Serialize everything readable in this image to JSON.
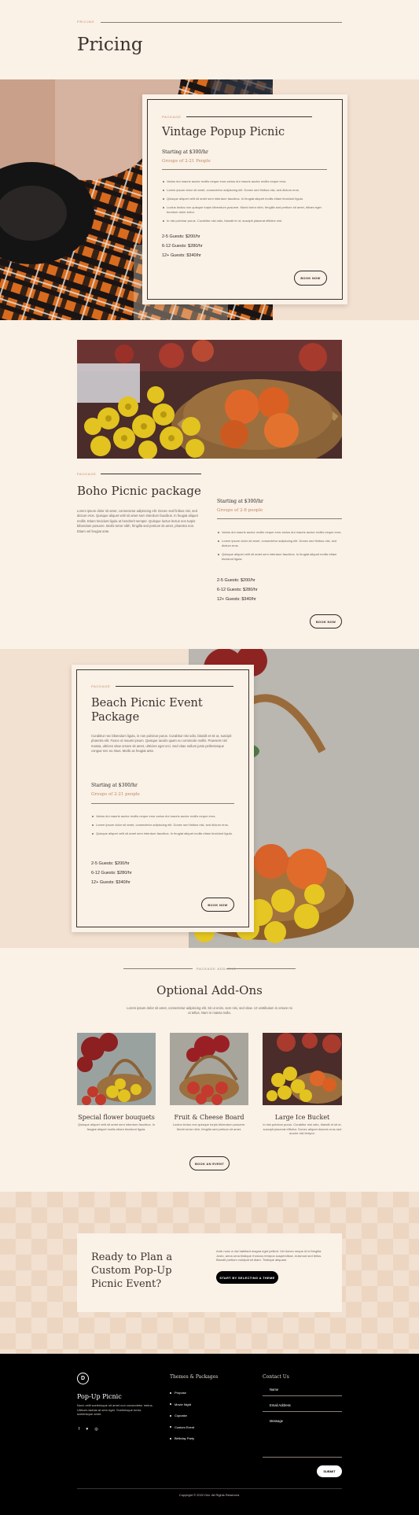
{
  "hero": {
    "eyebrow": "PRICING",
    "title": "Pricing"
  },
  "package1": {
    "eyebrow": "PACKAGE",
    "title": "Vintage Popup Picnic",
    "starting": "Starting at $300/hr",
    "groups": "Groups of 2-21 People",
    "bullets": [
      "Varius dui mauris auctor mollis neque eros varius dui mauris auctor mollis neque eros.",
      "Lorem ipsum dolor sit amet, consectetur adipiscing elit. Donec sed finibus nisi, sed dictum eros.",
      "Quisque aliquet velit sit amet sem interdum faucibus. In feugiat aliquet mollis etiam tincidunt ligula.",
      "Luctus lectus non quisque turpis bibendum posuere. Morbi tortor nibh, fringilla sed pretium sit amet, dibam eget bendum dolor tortor.",
      "In nisi pulvinar purus. Curabitur nisi odio, blandit et ut, suscipit placerat efficitur nisi."
    ],
    "tiers": [
      "2-5 Guests: $200/hr",
      "6-12 Guests: $280/hr",
      "12+ Guests: $340/hr"
    ],
    "button": "BOOK NOW"
  },
  "package2": {
    "eyebrow": "PACKAGE",
    "title": "Boho Picnic package",
    "desc": "Lorem ipsum dolor sit amet, consectetur adipiscing elit. Donec sed finibus nisi, sed dictum eros. Quisque aliquet velit sit amet sem interdum faucibus. In feugiat aliquet mollis. Etiam tincidunt ligula at hendrerit semper. Quisque luctus lectus non turpis bibendum posuere. Morbi tortor nibh, fringilla sed pretium sit amet, pharetra non. Etiam vel feugiat ante.",
    "starting": "Starting at $300/hr",
    "groups": "Groups of 2-8 people",
    "bullets": [
      "Varius dui mauris auctor mollis neque eros varius dui mauris auctor mollis neque eros.",
      "Lorem ipsum dolor sit amet, consectetur adipiscing elit. Donec sed finibus nisi, sed dictum eros.",
      "Quisque aliquet velit sit amet sem interdum faucibus. In feugiat aliquet mollis etiam tincidunt ligula."
    ],
    "tiers": [
      "2-5 Guests: $200/hr",
      "6-12 Guests: $280/hr",
      "12+ Guests: $340/hr"
    ],
    "button": "BOOK NOW"
  },
  "package3": {
    "eyebrow": "PACKAGE",
    "title": "Beach Picnic Event Package",
    "desc": "Curabitur nec bibendum ligula, in non pulvinar purus. Curabitur nisi odio, blandit et sit ut, suscipit pharetra elit. Fusce ut mauris ipsum. Quisque iaculis quam eu commodo mollis. Praesent nisl massa, ultrices vitae ornare sit amet, ultricies eget orci. Sed vitae nullum justo pellentesque congue nec eu risus. Morbi ac feugiat ante.",
    "starting": "Starting at $300/hr",
    "groups": "Groups of 2-21 people",
    "bullets": [
      "Varius dui mauris auctor mollis neque eros varius dui mauris auctor mollis neque eros.",
      "Lorem ipsum dolor sit amet, consectetur adipiscing elit. Donec sed finibus nisi, sed dictum eros.",
      "Quisque aliquet velit sit amet sem interdum faucibus. In feugiat aliquet mollis etiam tincidunt ligula."
    ],
    "tiers": [
      "2-5 Guests: $200/hr",
      "6-12 Guests: $280/hr",
      "12+ Guests: $340/hr"
    ],
    "button": "BOOK NOW"
  },
  "addons": {
    "eyebrow": "PACKAGE ADD-ONS",
    "title": "Optional Add-Ons",
    "desc": "Lorem ipsum dolor sit amet, consectetur adipiscing elit. Sit ut enim, sem nisi, sed vitae. Ut vestibulum in ornare mi ut tellus. Nam in massa nulla.",
    "items": [
      {
        "title": "Special flower bouquets",
        "desc": "Quisque aliquet velit sit amet sem interdum faucibus. In feugiat aliquet mollis etiam tincidunt ligula."
      },
      {
        "title": "Fruit & Cheese Board",
        "desc": "Luctus lectus non quisque turpis bibendum posuere. Morbi tortor nibh, fringilla sed pretium sit amet."
      },
      {
        "title": "Large Ice Bucket",
        "desc": "In nisi pulvinar purus. Curabitur nisi odio, blandit et sit ut, suscipit placerat efficitur. Donec aliquet dolores eros sed auctor nisl tempor."
      }
    ],
    "button": "BOOK AN EVENT"
  },
  "cta": {
    "title": "Ready to Plan a Custom Pop-Up Picnic Event?",
    "desc": "Ante nunc a nisi habitant magna eget pellent. Vel donec neque id id fringilla. Justo, anna urna tristique rhoncus tempus suspendisse, euismod sed tellus. Blandit pretium volutpat sit diam. Tristique aliquam.",
    "button": "START BY SELECTING A THEME"
  },
  "footer": {
    "logo": "D",
    "brand": "Pop-Up Picnic",
    "blurb": "Nunc velit scelerisque sit amet non consectetur metus. Ultrices lacinia at sem eget. Scelerisque tortor, scelerisque amet.",
    "nav_title": "Themes & Packages",
    "nav": [
      "Propose",
      "Movie Night",
      "Cupcake",
      "Custom Event",
      "Birthday Party"
    ],
    "contact_title": "Contact Us",
    "name_placeholder": "Name",
    "email_placeholder": "Email Address",
    "message_placeholder": "Message",
    "submit": "SUBMIT",
    "copyright": "Copyright © 2022 Divi. All Rights Reserved."
  },
  "colors": {
    "accent": "#c0855e",
    "cream": "#faf1e7",
    "peach": "#f2e0d0",
    "dark": "#000000"
  }
}
